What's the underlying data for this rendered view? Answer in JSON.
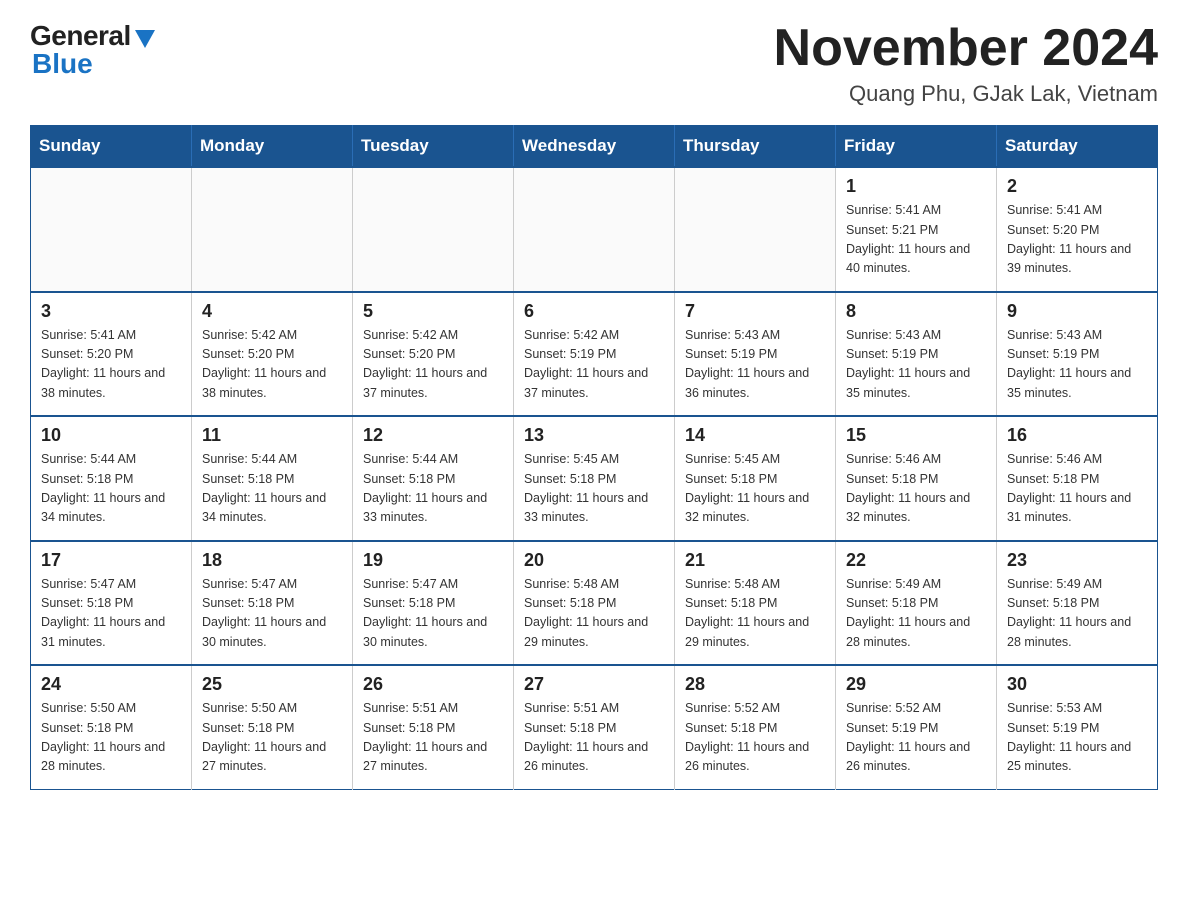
{
  "logo": {
    "general": "General",
    "blue": "Blue"
  },
  "title": "November 2024",
  "subtitle": "Quang Phu, GJak Lak, Vietnam",
  "days_of_week": [
    "Sunday",
    "Monday",
    "Tuesday",
    "Wednesday",
    "Thursday",
    "Friday",
    "Saturday"
  ],
  "weeks": [
    [
      {
        "day": "",
        "info": ""
      },
      {
        "day": "",
        "info": ""
      },
      {
        "day": "",
        "info": ""
      },
      {
        "day": "",
        "info": ""
      },
      {
        "day": "",
        "info": ""
      },
      {
        "day": "1",
        "info": "Sunrise: 5:41 AM\nSunset: 5:21 PM\nDaylight: 11 hours and 40 minutes."
      },
      {
        "day": "2",
        "info": "Sunrise: 5:41 AM\nSunset: 5:20 PM\nDaylight: 11 hours and 39 minutes."
      }
    ],
    [
      {
        "day": "3",
        "info": "Sunrise: 5:41 AM\nSunset: 5:20 PM\nDaylight: 11 hours and 38 minutes."
      },
      {
        "day": "4",
        "info": "Sunrise: 5:42 AM\nSunset: 5:20 PM\nDaylight: 11 hours and 38 minutes."
      },
      {
        "day": "5",
        "info": "Sunrise: 5:42 AM\nSunset: 5:20 PM\nDaylight: 11 hours and 37 minutes."
      },
      {
        "day": "6",
        "info": "Sunrise: 5:42 AM\nSunset: 5:19 PM\nDaylight: 11 hours and 37 minutes."
      },
      {
        "day": "7",
        "info": "Sunrise: 5:43 AM\nSunset: 5:19 PM\nDaylight: 11 hours and 36 minutes."
      },
      {
        "day": "8",
        "info": "Sunrise: 5:43 AM\nSunset: 5:19 PM\nDaylight: 11 hours and 35 minutes."
      },
      {
        "day": "9",
        "info": "Sunrise: 5:43 AM\nSunset: 5:19 PM\nDaylight: 11 hours and 35 minutes."
      }
    ],
    [
      {
        "day": "10",
        "info": "Sunrise: 5:44 AM\nSunset: 5:18 PM\nDaylight: 11 hours and 34 minutes."
      },
      {
        "day": "11",
        "info": "Sunrise: 5:44 AM\nSunset: 5:18 PM\nDaylight: 11 hours and 34 minutes."
      },
      {
        "day": "12",
        "info": "Sunrise: 5:44 AM\nSunset: 5:18 PM\nDaylight: 11 hours and 33 minutes."
      },
      {
        "day": "13",
        "info": "Sunrise: 5:45 AM\nSunset: 5:18 PM\nDaylight: 11 hours and 33 minutes."
      },
      {
        "day": "14",
        "info": "Sunrise: 5:45 AM\nSunset: 5:18 PM\nDaylight: 11 hours and 32 minutes."
      },
      {
        "day": "15",
        "info": "Sunrise: 5:46 AM\nSunset: 5:18 PM\nDaylight: 11 hours and 32 minutes."
      },
      {
        "day": "16",
        "info": "Sunrise: 5:46 AM\nSunset: 5:18 PM\nDaylight: 11 hours and 31 minutes."
      }
    ],
    [
      {
        "day": "17",
        "info": "Sunrise: 5:47 AM\nSunset: 5:18 PM\nDaylight: 11 hours and 31 minutes."
      },
      {
        "day": "18",
        "info": "Sunrise: 5:47 AM\nSunset: 5:18 PM\nDaylight: 11 hours and 30 minutes."
      },
      {
        "day": "19",
        "info": "Sunrise: 5:47 AM\nSunset: 5:18 PM\nDaylight: 11 hours and 30 minutes."
      },
      {
        "day": "20",
        "info": "Sunrise: 5:48 AM\nSunset: 5:18 PM\nDaylight: 11 hours and 29 minutes."
      },
      {
        "day": "21",
        "info": "Sunrise: 5:48 AM\nSunset: 5:18 PM\nDaylight: 11 hours and 29 minutes."
      },
      {
        "day": "22",
        "info": "Sunrise: 5:49 AM\nSunset: 5:18 PM\nDaylight: 11 hours and 28 minutes."
      },
      {
        "day": "23",
        "info": "Sunrise: 5:49 AM\nSunset: 5:18 PM\nDaylight: 11 hours and 28 minutes."
      }
    ],
    [
      {
        "day": "24",
        "info": "Sunrise: 5:50 AM\nSunset: 5:18 PM\nDaylight: 11 hours and 28 minutes."
      },
      {
        "day": "25",
        "info": "Sunrise: 5:50 AM\nSunset: 5:18 PM\nDaylight: 11 hours and 27 minutes."
      },
      {
        "day": "26",
        "info": "Sunrise: 5:51 AM\nSunset: 5:18 PM\nDaylight: 11 hours and 27 minutes."
      },
      {
        "day": "27",
        "info": "Sunrise: 5:51 AM\nSunset: 5:18 PM\nDaylight: 11 hours and 26 minutes."
      },
      {
        "day": "28",
        "info": "Sunrise: 5:52 AM\nSunset: 5:18 PM\nDaylight: 11 hours and 26 minutes."
      },
      {
        "day": "29",
        "info": "Sunrise: 5:52 AM\nSunset: 5:19 PM\nDaylight: 11 hours and 26 minutes."
      },
      {
        "day": "30",
        "info": "Sunrise: 5:53 AM\nSunset: 5:19 PM\nDaylight: 11 hours and 25 minutes."
      }
    ]
  ]
}
